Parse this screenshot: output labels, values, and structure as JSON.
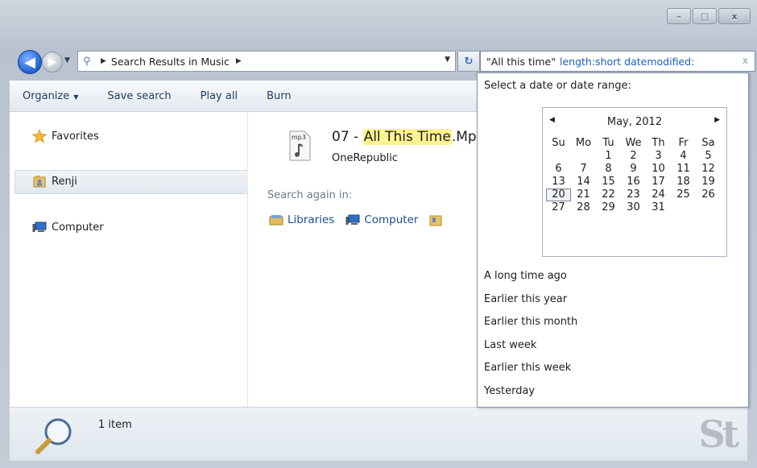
{
  "window": {
    "controls": {
      "minimize": "–",
      "maximize": "□",
      "close": "x"
    }
  },
  "nav": {
    "address_crumb": "Search Results in Music",
    "search_query": "\"All this time\"",
    "search_filters": "length:short datemodified:",
    "clear_icon": "x"
  },
  "toolbar": {
    "organize": "Organize",
    "save_search": "Save search",
    "play_all": "Play all",
    "burn": "Burn"
  },
  "sidebar": {
    "items": [
      {
        "label": "Favorites",
        "icon": "star-icon"
      },
      {
        "label": "Renji",
        "icon": "user-folder-icon"
      },
      {
        "label": "Computer",
        "icon": "computer-icon"
      }
    ]
  },
  "results": {
    "file_prefix": "07 - ",
    "file_highlight": "All This Time",
    "file_suffix": ".Mp",
    "artist": "OneRepublic",
    "search_again_label": "Search again in:",
    "search_again_locations": [
      "Libraries",
      "Computer"
    ]
  },
  "date_popup": {
    "title": "Select a date or date range:",
    "calendar": {
      "month_year": "May, 2012",
      "weekdays": [
        "Su",
        "Mo",
        "Tu",
        "We",
        "Th",
        "Fr",
        "Sa"
      ],
      "weeks": [
        [
          "",
          "",
          "1",
          "2",
          "3",
          "4",
          "5"
        ],
        [
          "6",
          "7",
          "8",
          "9",
          "10",
          "11",
          "12"
        ],
        [
          "13",
          "14",
          "15",
          "16",
          "17",
          "18",
          "19"
        ],
        [
          "20",
          "21",
          "22",
          "23",
          "24",
          "25",
          "26"
        ],
        [
          "27",
          "28",
          "29",
          "30",
          "31",
          "",
          ""
        ]
      ],
      "today": "20"
    },
    "options": [
      "A long time ago",
      "Earlier this year",
      "Earlier this month",
      "Last week",
      "Earlier this week",
      "Yesterday"
    ]
  },
  "status": {
    "item_count": "1 item"
  },
  "colors": {
    "accent": "#1d5fc5",
    "highlight": "#fff48e"
  }
}
